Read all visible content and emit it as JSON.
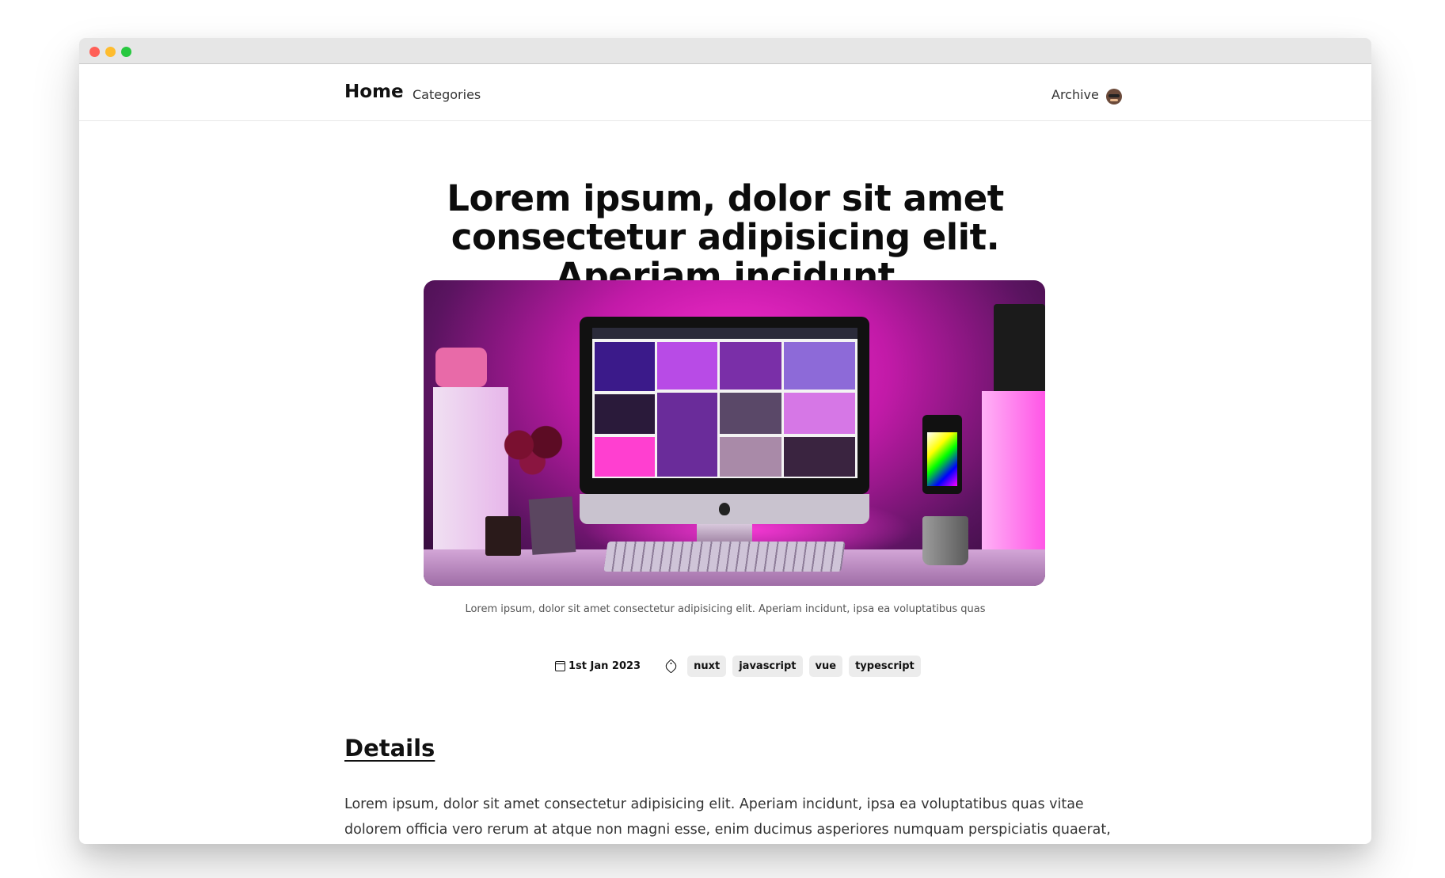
{
  "navbar": {
    "home_label": "Home",
    "categories_label": "Categories",
    "archive_label": "Archive"
  },
  "article": {
    "title": "Lorem ipsum, dolor sit amet consectetur adipisicing elit. Aperiam incidunt",
    "image_caption": "Lorem ipsum, dolor sit amet consectetur adipisicing elit. Aperiam incidunt, ipsa ea voluptatibus quas",
    "date": "1st Jan 2023",
    "tags": [
      "nuxt",
      "javascript",
      "vue",
      "typescript"
    ],
    "section_heading": "Details",
    "body": "Lorem ipsum, dolor sit amet consectetur adipisicing elit. Aperiam incidunt, ipsa ea voluptatibus quas vitae dolorem officia vero rerum at atque non magni esse, enim ducimus asperiores numquam perspiciatis quaerat,"
  },
  "icons": {
    "date": "calendar-icon",
    "tags": "tag-icon",
    "avatar": "avatar-emoji"
  },
  "colors": {
    "hero_accent": "#ff2fd2",
    "tag_background": "#ececec",
    "traffic_red": "#ff5f57",
    "traffic_yellow": "#febc2e",
    "traffic_green": "#28c840"
  }
}
